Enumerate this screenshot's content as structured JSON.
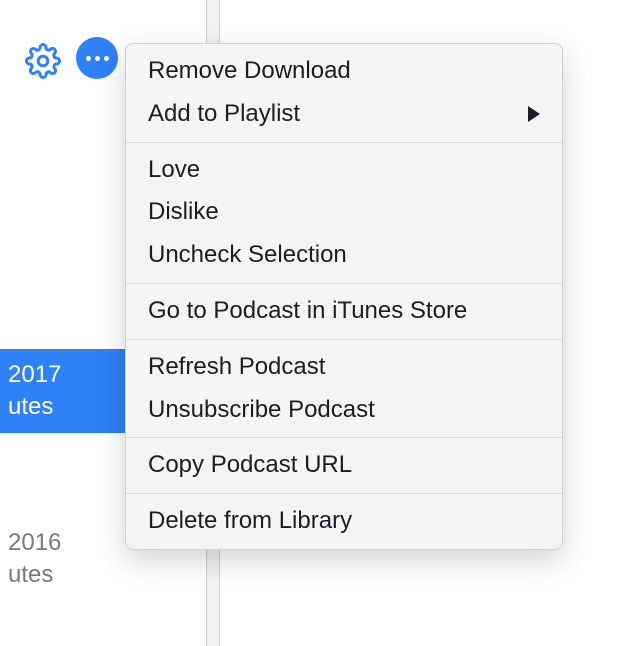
{
  "toolbar": {
    "settings_icon": "settings",
    "more_icon": "more"
  },
  "sidebar": {
    "selected": {
      "line1": "2017",
      "line2": "utes"
    },
    "other": {
      "line1": "2016",
      "line2": "utes"
    }
  },
  "menu": {
    "groups": [
      [
        {
          "key": "remove-download",
          "label": "Remove Download",
          "submenu": false
        },
        {
          "key": "add-to-playlist",
          "label": "Add to Playlist",
          "submenu": true
        }
      ],
      [
        {
          "key": "love",
          "label": "Love",
          "submenu": false
        },
        {
          "key": "dislike",
          "label": "Dislike",
          "submenu": false
        },
        {
          "key": "uncheck-selection",
          "label": "Uncheck Selection",
          "submenu": false
        }
      ],
      [
        {
          "key": "go-to-store",
          "label": "Go to Podcast in iTunes Store",
          "submenu": false
        }
      ],
      [
        {
          "key": "refresh-podcast",
          "label": "Refresh Podcast",
          "submenu": false
        },
        {
          "key": "unsubscribe",
          "label": "Unsubscribe Podcast",
          "submenu": false
        }
      ],
      [
        {
          "key": "copy-url",
          "label": "Copy Podcast URL",
          "submenu": false
        }
      ],
      [
        {
          "key": "delete-library",
          "label": "Delete from Library",
          "submenu": false
        }
      ]
    ]
  }
}
